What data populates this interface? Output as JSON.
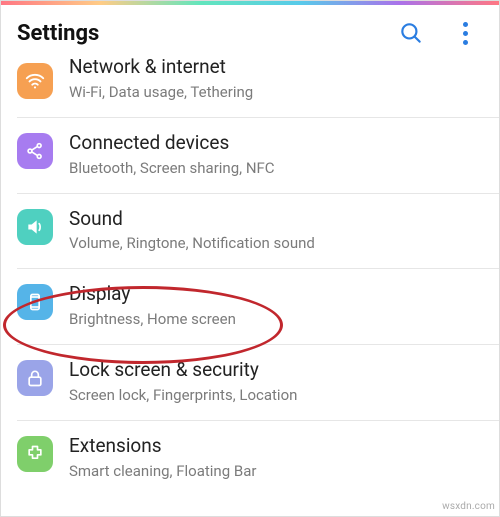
{
  "header": {
    "title": "Settings"
  },
  "items": [
    {
      "title": "Network & internet",
      "subtitle": "Wi-Fi, Data usage, Tethering"
    },
    {
      "title": "Connected devices",
      "subtitle": "Bluetooth, Screen sharing, NFC"
    },
    {
      "title": "Sound",
      "subtitle": "Volume, Ringtone, Notification sound"
    },
    {
      "title": "Display",
      "subtitle": "Brightness, Home screen"
    },
    {
      "title": "Lock screen & security",
      "subtitle": "Screen lock, Fingerprints, Location"
    },
    {
      "title": "Extensions",
      "subtitle": "Smart cleaning, Floating Bar"
    }
  ],
  "attribution": "wsxdn.com"
}
